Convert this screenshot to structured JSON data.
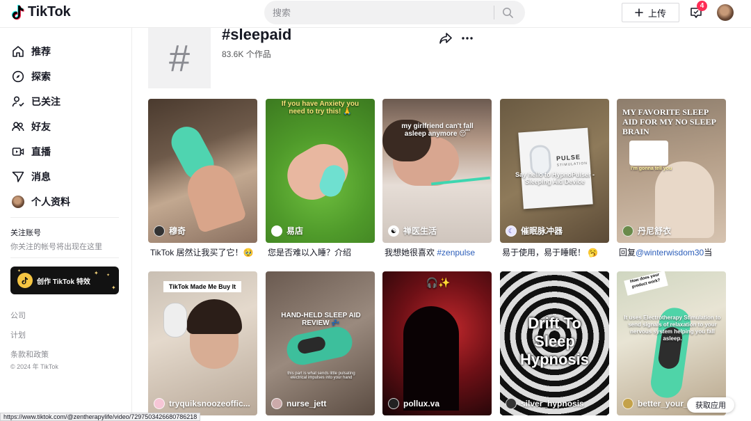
{
  "header": {
    "brand": "TikTok",
    "search_placeholder": "搜索",
    "upload_label": "上传",
    "inbox_badge": "4"
  },
  "sidebar": {
    "nav": [
      {
        "label": "推荐",
        "icon": "home-icon"
      },
      {
        "label": "探索",
        "icon": "compass-icon"
      },
      {
        "label": "已关注",
        "icon": "following-icon"
      },
      {
        "label": "好友",
        "icon": "friends-icon"
      },
      {
        "label": "直播",
        "icon": "live-icon"
      },
      {
        "label": "消息",
        "icon": "message-icon"
      },
      {
        "label": "个人资料",
        "icon": "profile-avatar"
      }
    ],
    "follow_title": "关注账号",
    "follow_sub": "你关注的帐号将出现在这里",
    "effect_button": "创作 TikTok 特效",
    "footer": {
      "company": "公司",
      "program": "计划",
      "terms": "条款和政策",
      "copyright": "© 2024 年 TikTok"
    }
  },
  "hashtag": {
    "symbol": "#",
    "title": "#sleepaid",
    "count": "83.6K 个作品"
  },
  "videos": [
    {
      "username": "穆奇",
      "caption": "TikTok 居然让我买了它！🥹",
      "overlay": ""
    },
    {
      "username": "易店",
      "caption": "您是否难以入睡？介绍",
      "overlay": "If you have Anxiety you need to try this! 🙏"
    },
    {
      "username": "禅医生活",
      "caption_pre": "我想她很喜欢 ",
      "caption_tag": "#zenpulse",
      "overlay": "my girlfriend can't fall asleep anymore 😴"
    },
    {
      "username": "催眠脉冲器",
      "caption": "易于使用，易于睡眠！ 🥱",
      "overlay": "Say hello to HypnoPulser - Sleeping Aid Device",
      "box_brand": "PULSE",
      "box_sub": "STIMULATION"
    },
    {
      "username": "丹尼舒衣",
      "caption_pre": "回复",
      "caption_tag": "@winterwisdom30",
      "caption_post": "当",
      "overlay": "MY FAVORITE SLEEP AID FOR MY NO SLEEP BRAIN",
      "overlay_small": "I'm gonna tell you"
    },
    {
      "username": "tryquiksnoozeoffic...",
      "caption": "",
      "overlay": "TikTok Made Me Buy It"
    },
    {
      "username": "nurse_jett",
      "caption": "",
      "overlay": "HAND-HELD SLEEP AID REVIEW 💤",
      "overlay_small": "this part is what sends little pulsating electrical impulses into your hand"
    },
    {
      "username": "pollux.va",
      "caption": "",
      "overlay": "🎧✨"
    },
    {
      "username": "silver_hypnosis",
      "caption": "",
      "overlay": "Drift To Sleep Hypnosis"
    },
    {
      "username": "better_your_l",
      "caption": "",
      "overlay": "It uses Electrotherapy Stimulation to send signals of relaxation to your nervous system helping you fall asleep.",
      "overlay_small": "How does your product work?"
    }
  ],
  "status_url": "https://www.tiktok.com/@zentherapylife/video/7297503426680786218",
  "get_app": "获取应用",
  "colors": {
    "accent": "#fe2c55",
    "link": "#2b5db9",
    "text": "#161823",
    "muted": "#8a8b91"
  }
}
